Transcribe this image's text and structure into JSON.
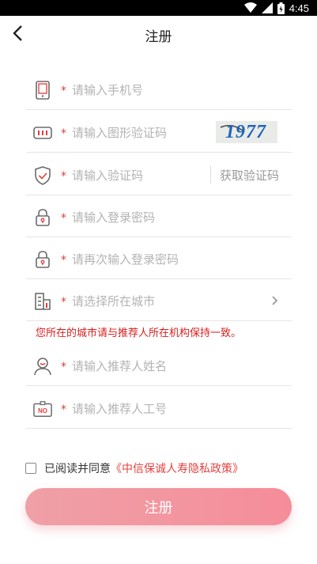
{
  "status_bar": {
    "time": "4:45"
  },
  "header": {
    "title": "注册"
  },
  "form": {
    "phone": {
      "placeholder": "请输入手机号"
    },
    "image_code": {
      "placeholder": "请输入图形验证码",
      "captcha_text": "1977"
    },
    "sms_code": {
      "placeholder": "请输入验证码",
      "get_code_label": "获取验证码"
    },
    "password": {
      "placeholder": "请输入登录密码"
    },
    "password_confirm": {
      "placeholder": "请再次输入登录密码"
    },
    "city": {
      "placeholder": "请选择所在城市"
    },
    "notice": "您所在的城市请与推荐人所在机构保持一致。",
    "referrer_name": {
      "placeholder": "请输入推荐人姓名"
    },
    "referrer_id": {
      "placeholder": "请输入推荐人工号",
      "badge": "NO"
    },
    "required_mark": "*"
  },
  "agreement": {
    "prefix": "已阅读并同意",
    "policy_link": "《中信保诚人寿隐私政策》"
  },
  "submit": {
    "label": "注册"
  },
  "colors": {
    "accent": "#e23c3c",
    "button": "#f29aa3"
  }
}
